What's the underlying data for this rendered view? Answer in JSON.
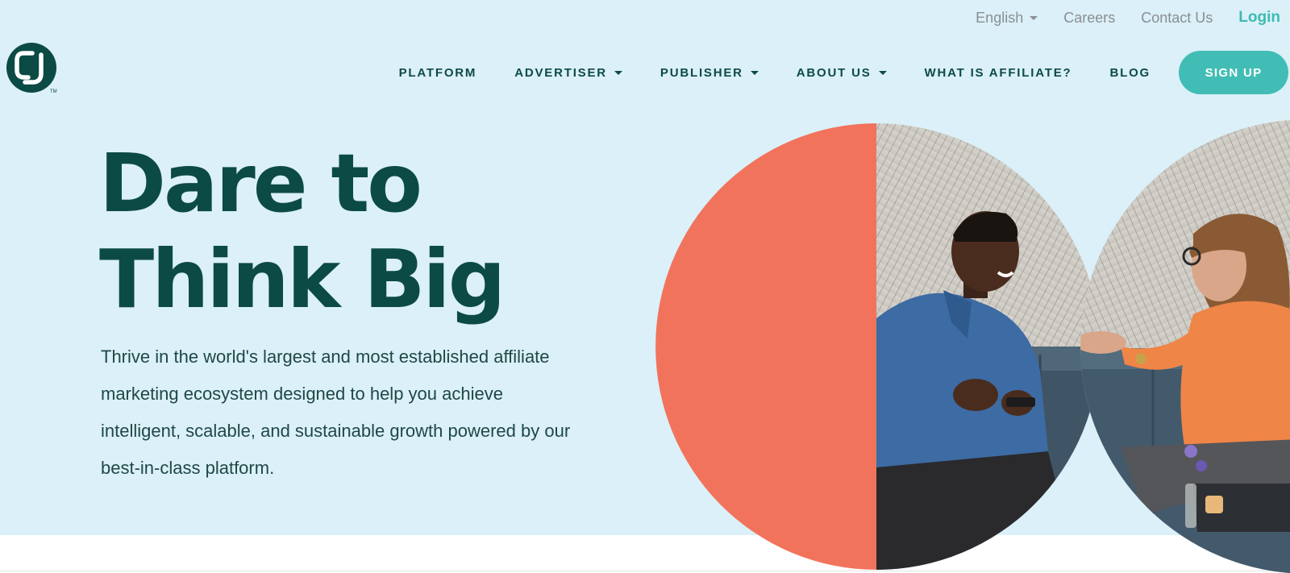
{
  "utility_nav": {
    "language": "English",
    "careers": "Careers",
    "contact": "Contact Us",
    "login": "Login"
  },
  "logo": {
    "alt": "CJ logo",
    "trademark": "TM"
  },
  "main_nav": {
    "items": [
      {
        "label": "PLATFORM",
        "dropdown": false
      },
      {
        "label": "ADVERTISER",
        "dropdown": true
      },
      {
        "label": "PUBLISHER",
        "dropdown": true
      },
      {
        "label": "ABOUT US",
        "dropdown": true
      },
      {
        "label": "WHAT IS AFFILIATE?",
        "dropdown": false
      },
      {
        "label": "BLOG",
        "dropdown": false
      }
    ],
    "signup": "SIGN UP"
  },
  "hero": {
    "title_line1": "Dare to",
    "title_line2": "Think Big",
    "description": "Thrive in the world's largest and most established affiliate marketing ecosystem designed to help you achieve intelligent, scalable, and sustainable growth powered by our best-in-class platform.",
    "image_alt": "Two people talking on a couch"
  },
  "colors": {
    "hero_background": "#dbf0f8",
    "brand_dark": "#0c4a45",
    "accent_teal": "#42bdb5",
    "coral": "#f2735c",
    "utility_text": "#8a8f91"
  }
}
